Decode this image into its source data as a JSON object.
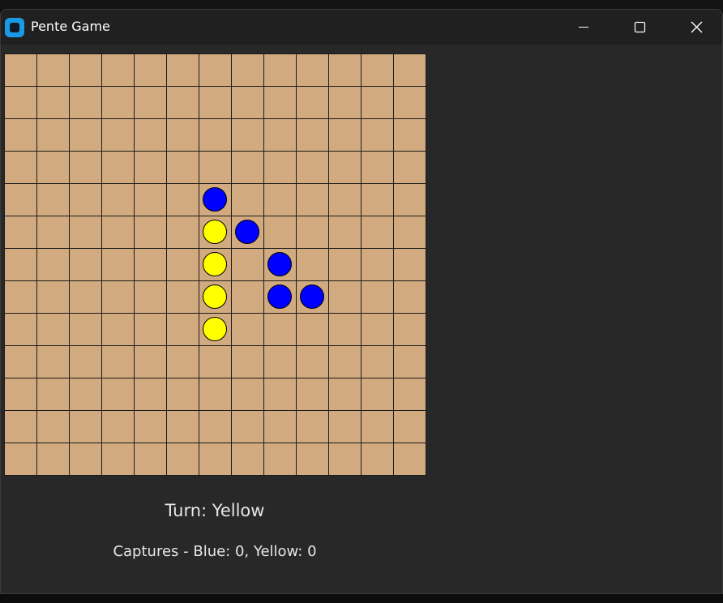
{
  "window": {
    "title": "Pente Game",
    "app_icon": "app-icon",
    "controls": {
      "minimize_icon": "minimize-icon",
      "maximize_icon": "maximize-icon",
      "close_icon": "close-icon"
    }
  },
  "board": {
    "rows": 13,
    "cols": 13,
    "board_color": "#d2aa7f",
    "line_color": "#1c1c1c",
    "stones": [
      {
        "color": "blue",
        "row": 4,
        "col": 6
      },
      {
        "color": "yellow",
        "row": 5,
        "col": 6
      },
      {
        "color": "blue",
        "row": 5,
        "col": 7
      },
      {
        "color": "yellow",
        "row": 6,
        "col": 6
      },
      {
        "color": "blue",
        "row": 6,
        "col": 8
      },
      {
        "color": "yellow",
        "row": 7,
        "col": 6
      },
      {
        "color": "blue",
        "row": 7,
        "col": 8
      },
      {
        "color": "blue",
        "row": 7,
        "col": 9
      },
      {
        "color": "yellow",
        "row": 8,
        "col": 6
      }
    ],
    "stone_colors": {
      "blue": "#0000ff",
      "yellow": "#ffff00"
    }
  },
  "status": {
    "turn_text": "Turn: Yellow",
    "captures_text": "Captures - Blue: 0, Yellow: 0"
  }
}
